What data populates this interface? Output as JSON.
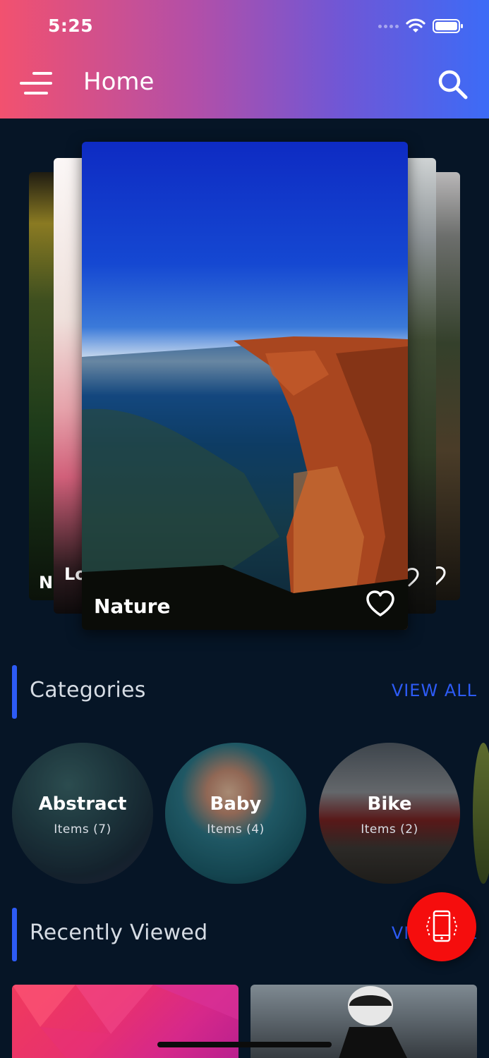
{
  "status_bar": {
    "time": "5:25"
  },
  "header": {
    "title": "Home"
  },
  "carousel": {
    "main": {
      "label": "Nature",
      "favorite": false
    },
    "side_labels": {
      "far_left": "N",
      "left": "Lo"
    }
  },
  "categories": {
    "title": "Categories",
    "view_all": "VIEW ALL",
    "items": [
      {
        "name": "Abstract",
        "count": "Items (7)"
      },
      {
        "name": "Baby",
        "count": "Items (4)"
      },
      {
        "name": "Bike",
        "count": "Items (2)"
      }
    ]
  },
  "recently_viewed": {
    "title": "Recently Viewed",
    "view_all": "VIEW ALL"
  },
  "colors": {
    "accent": "#2d5bf5",
    "background": "#061526",
    "fab": "#f50d0d",
    "header_gradient": [
      "#f2516f",
      "#b24fa8",
      "#6f57d6",
      "#3c6bf7"
    ]
  },
  "icons": {
    "menu": "hamburger-icon",
    "search": "search-icon",
    "favorite": "heart-outline-icon",
    "fab": "phone-shake-icon"
  }
}
